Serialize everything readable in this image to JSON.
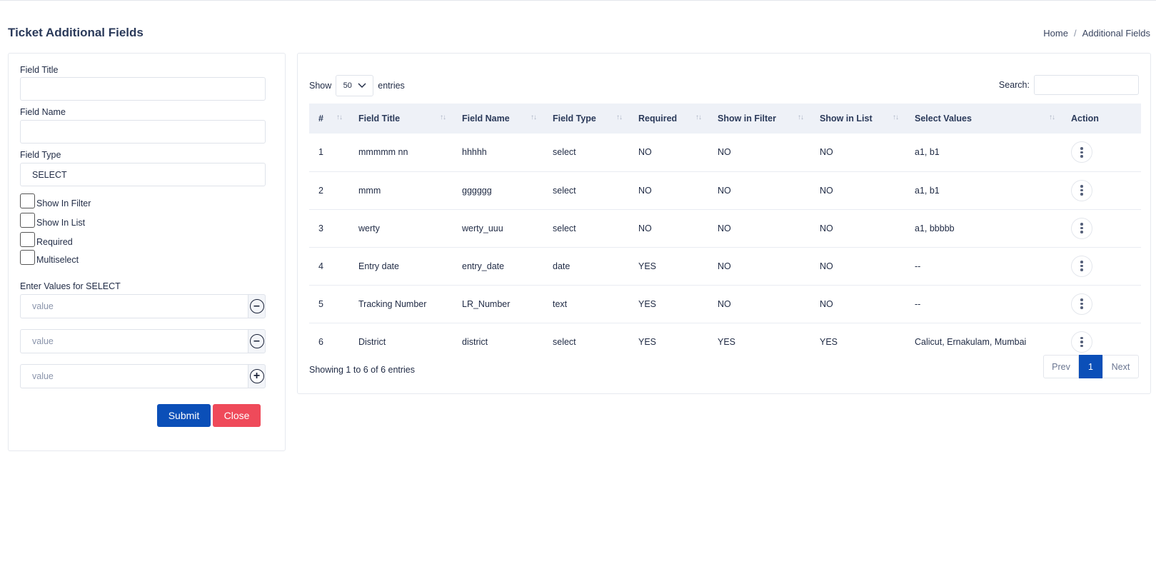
{
  "header": {
    "title": "Ticket Additional Fields",
    "breadcrumb": [
      "Home",
      "Additional Fields"
    ],
    "breadcrumb_sep": "/"
  },
  "form": {
    "field_title_label": "Field Title",
    "field_title_value": "",
    "field_name_label": "Field Name",
    "field_name_value": "",
    "field_type_label": "Field Type",
    "field_type_value": "SELECT",
    "checkboxes": [
      {
        "label": "Show In Filter",
        "checked": false
      },
      {
        "label": "Show In List",
        "checked": false
      },
      {
        "label": "Required",
        "checked": false
      },
      {
        "label": "Multiselect",
        "checked": false
      }
    ],
    "values_label": "Enter Values for SELECT",
    "value_placeholder": "value",
    "value_rows": [
      {
        "icon": "minus-circle-icon"
      },
      {
        "icon": "minus-circle-icon"
      },
      {
        "icon": "plus-circle-icon"
      }
    ],
    "submit_label": "Submit",
    "close_label": "Close"
  },
  "table": {
    "show_label": "Show",
    "entries_value": "50",
    "entries_label": "entries",
    "search_label": "Search:",
    "columns": [
      "#",
      "Field Title",
      "Field Name",
      "Field Type",
      "Required",
      "Show in Filter",
      "Show in List",
      "Select Values",
      "Action"
    ],
    "rows": [
      [
        "1",
        "mmmmm nn",
        "hhhhh",
        "select",
        "NO",
        "NO",
        "NO",
        "a1, b1"
      ],
      [
        "2",
        "mmm",
        "gggggg",
        "select",
        "NO",
        "NO",
        "NO",
        "a1, b1"
      ],
      [
        "3",
        "werty",
        "werty_uuu",
        "select",
        "NO",
        "NO",
        "NO",
        "a1, bbbbb"
      ],
      [
        "4",
        "Entry date",
        "entry_date",
        "date",
        "YES",
        "NO",
        "NO",
        "--"
      ],
      [
        "5",
        "Tracking Number",
        "LR_Number",
        "text",
        "YES",
        "NO",
        "NO",
        "--"
      ],
      [
        "6",
        "District",
        "district",
        "select",
        "YES",
        "YES",
        "YES",
        "Calicut, Ernakulam, Mumbai"
      ]
    ],
    "info": "Showing 1 to 6 of 6 entries",
    "pager": {
      "prev": "Prev",
      "current": "1",
      "next": "Next"
    }
  },
  "colors": {
    "primary": "#0b4fb8",
    "danger": "#ef4a5a",
    "header_bg": "#eef1f7"
  }
}
